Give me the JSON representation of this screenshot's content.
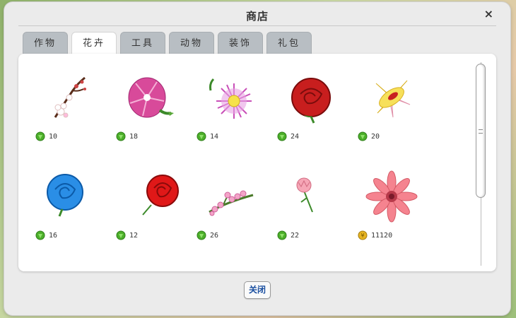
{
  "window": {
    "title": "商店",
    "close_icon": "×"
  },
  "tabs": [
    {
      "label": "作物",
      "active": false
    },
    {
      "label": "花卉",
      "active": true
    },
    {
      "label": "工具",
      "active": false
    },
    {
      "label": "动物",
      "active": false
    },
    {
      "label": "装饰",
      "active": false
    },
    {
      "label": "礼包",
      "active": false
    }
  ],
  "items": [
    {
      "name": "plum-blossom",
      "price": "10",
      "currency": "green-gem-icon"
    },
    {
      "name": "morning-glory",
      "price": "18",
      "currency": "green-gem-icon"
    },
    {
      "name": "pink-aster",
      "price": "14",
      "currency": "green-gem-icon"
    },
    {
      "name": "red-rose",
      "price": "24",
      "currency": "green-gem-icon"
    },
    {
      "name": "yellow-lily",
      "price": "20",
      "currency": "green-gem-icon"
    },
    {
      "name": "blue-rose",
      "price": "16",
      "currency": "green-gem-icon"
    },
    {
      "name": "red-rose-small",
      "price": "12",
      "currency": "green-gem-icon"
    },
    {
      "name": "peach-blossom-branch",
      "price": "26",
      "currency": "green-gem-icon"
    },
    {
      "name": "carnation",
      "price": "22",
      "currency": "green-gem-icon"
    },
    {
      "name": "gerbera",
      "price": "11120",
      "currency": "gold-coin-icon"
    }
  ],
  "footer": {
    "close_label": "关闭"
  },
  "colors": {
    "gem": "#4caf2a",
    "coin": "#e6b422",
    "link_blue": "#1a4fa0"
  }
}
